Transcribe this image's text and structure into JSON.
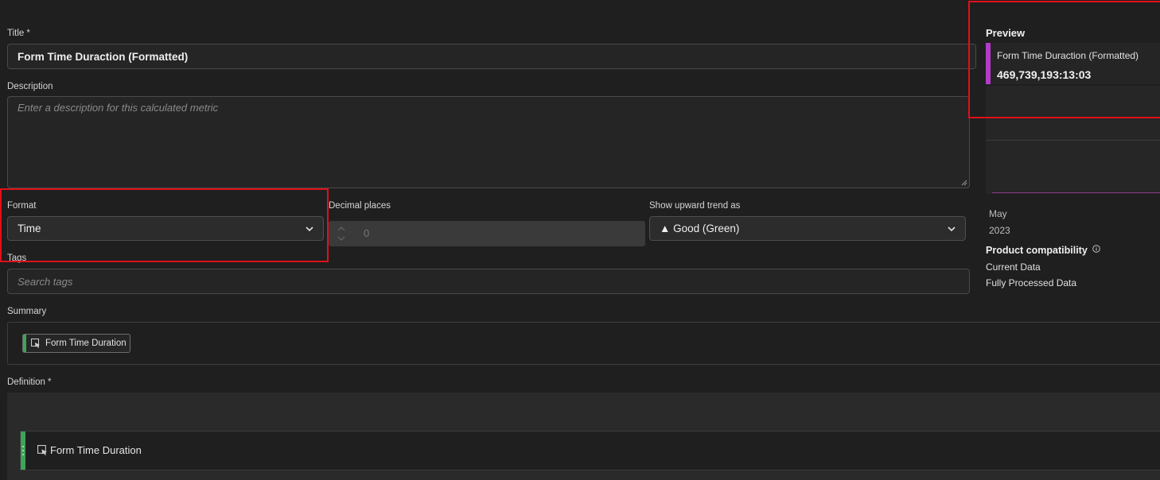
{
  "form": {
    "title_label": "Title",
    "required_mark": "*",
    "title_value": "Form Time Duraction (Formatted)",
    "description_label": "Description",
    "description_placeholder": "Enter a description for this calculated metric",
    "format_label": "Format",
    "format_value": "Time",
    "decimal_label": "Decimal places",
    "decimal_value": "0",
    "trend_label": "Show upward trend as",
    "trend_value": "▲ Good (Green)",
    "tags_label": "Tags",
    "tags_placeholder": "Search tags",
    "summary_label": "Summary",
    "summary_chip": "Form Time Duration",
    "definition_label": "Definition",
    "definition_item": "Form Time Duration"
  },
  "preview": {
    "heading": "Preview",
    "metric_name": "Form Time Duraction (Formatted)",
    "metric_value": "469,739,193:13:03",
    "chart_month": "May",
    "chart_year": "2023",
    "compat_heading": "Product compatibility",
    "compat_items": [
      "Current Data",
      "Fully Processed Data"
    ]
  },
  "colors": {
    "highlight_red": "#e0101a",
    "preview_accent": "#b43bc8",
    "chip_accent": "#3fa35a"
  }
}
